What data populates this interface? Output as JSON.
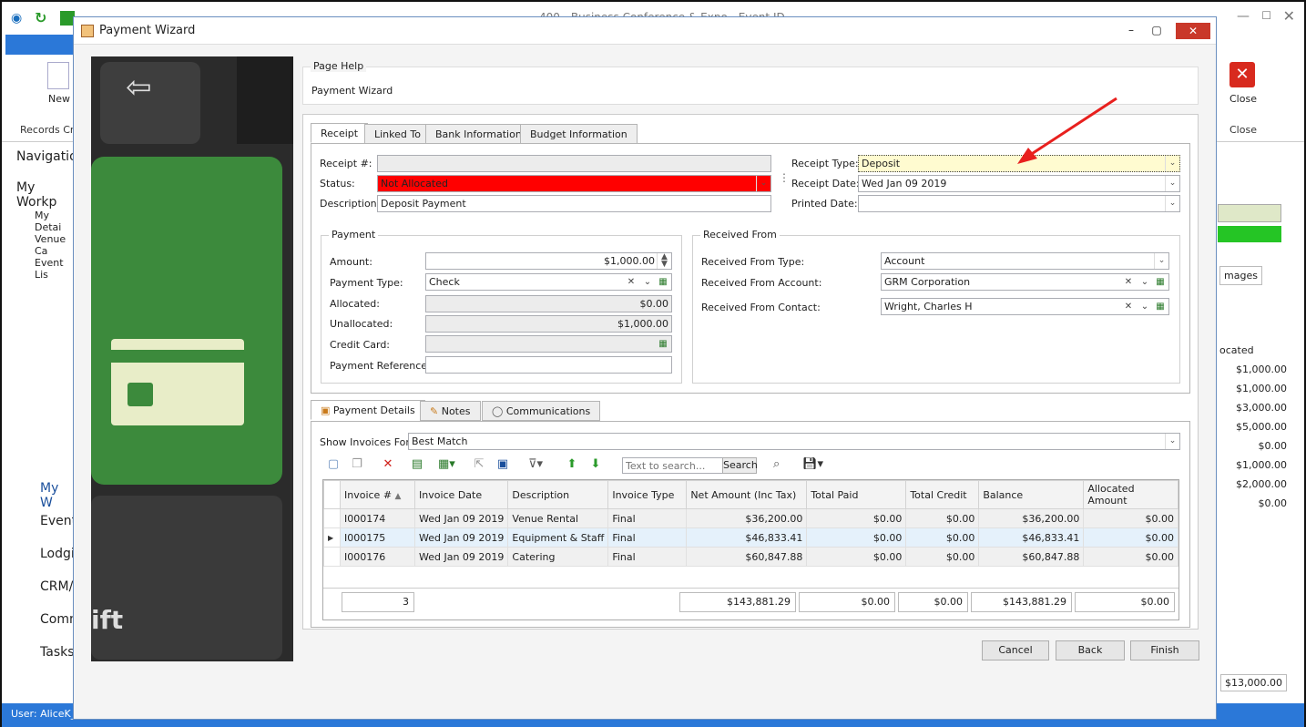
{
  "background": {
    "title": "400 - Business Conference & Expo - Event ID...",
    "ribbon": {
      "new_label": "New",
      "records_label": "Records Cre",
      "close_label": "Close",
      "close_group": "Close"
    },
    "nav": {
      "title": "Navigation",
      "workspace": "My Workp",
      "items": [
        "My Detai",
        "Venue Ca",
        "Event Lis"
      ]
    },
    "bottom_nav": [
      "My W",
      "Event",
      "Lodgin",
      "CRM/S",
      "Comm",
      "Tasks"
    ],
    "status": "User: AliceK_C",
    "right_panel": {
      "tab": "mages",
      "col": "ocated",
      "values": [
        "$1,000.00",
        "$1,000.00",
        "$3,000.00",
        "$5,000.00",
        "$0.00",
        "$1,000.00",
        "$2,000.00",
        "$0.00"
      ],
      "total": "$13,000.00"
    }
  },
  "dialog": {
    "title": "Payment Wizard",
    "page_help": {
      "legend": "Page Help",
      "text": "Payment Wizard"
    },
    "tabs": [
      "Receipt",
      "Linked To",
      "Bank Information",
      "Budget Information"
    ],
    "receipt": {
      "receipt_no_label": "Receipt #:",
      "receipt_no": "",
      "status_label": "Status:",
      "status": "Not Allocated",
      "description_label": "Description:",
      "description": "Deposit Payment",
      "receipt_type_label": "Receipt Type:",
      "receipt_type": "Deposit",
      "receipt_date_label": "Receipt Date:",
      "receipt_date": "Wed Jan 09 2019",
      "printed_date_label": "Printed Date:",
      "printed_date": ""
    },
    "payment": {
      "legend": "Payment",
      "amount_label": "Amount:",
      "amount": "$1,000.00",
      "type_label": "Payment Type:",
      "type": "Check",
      "allocated_label": "Allocated:",
      "allocated": "$0.00",
      "unallocated_label": "Unallocated:",
      "unallocated": "$1,000.00",
      "credit_card_label": "Credit Card:",
      "credit_card": "",
      "reference_label": "Payment Reference:",
      "reference": ""
    },
    "received_from": {
      "legend": "Received From",
      "type_label": "Received From Type:",
      "type": "Account",
      "account_label": "Received From Account:",
      "account": "GRM Corporation",
      "contact_label": "Received From Contact:",
      "contact": "Wright, Charles H"
    },
    "lower_tabs": [
      "Payment Details",
      "Notes",
      "Communications"
    ],
    "invoices_for_label": "Show Invoices For:",
    "invoices_for": "Best Match",
    "search_placeholder": "Text to search...",
    "search_button": "Search",
    "columns": [
      "Invoice #",
      "Invoice Date",
      "Description",
      "Invoice Type",
      "Net Amount (Inc Tax)",
      "Total Paid",
      "Total Credit",
      "Balance",
      "Allocated Amount"
    ],
    "rows": [
      [
        "I000174",
        "Wed Jan 09 2019",
        "Venue Rental",
        "Final",
        "$36,200.00",
        "$0.00",
        "$0.00",
        "$36,200.00",
        "$0.00"
      ],
      [
        "I000175",
        "Wed Jan 09 2019",
        "Equipment & Staff",
        "Final",
        "$46,833.41",
        "$0.00",
        "$0.00",
        "$46,833.41",
        "$0.00"
      ],
      [
        "I000176",
        "Wed Jan 09 2019",
        "Catering",
        "Final",
        "$60,847.88",
        "$0.00",
        "$0.00",
        "$60,847.88",
        "$0.00"
      ]
    ],
    "footer": {
      "count": "3",
      "net": "$143,881.29",
      "paid": "$0.00",
      "credit": "$0.00",
      "balance": "$143,881.29",
      "allocated": "$0.00"
    },
    "buttons": {
      "cancel": "Cancel",
      "back": "Back",
      "finish": "Finish"
    },
    "image_text": "ift",
    "colors": {
      "status_bg": "#ff0000",
      "receipt_type_bg": "#fffbd0",
      "arrow": "#e8201e",
      "selected_row": "#e5f1fb"
    }
  }
}
